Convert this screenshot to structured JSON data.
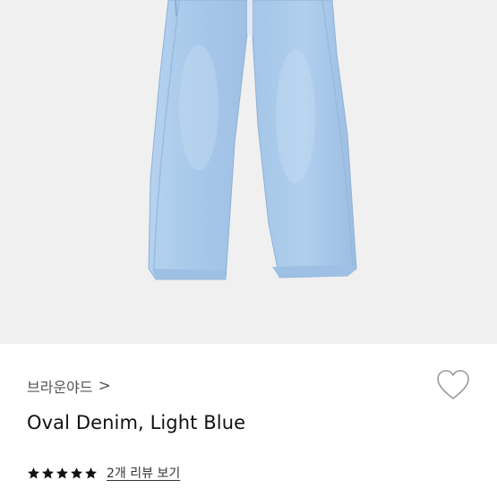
{
  "product": {
    "image_icon": "jeans-photo",
    "brand": "브라운야드",
    "brand_chevron": ">",
    "title": "Oval Denim, Light Blue",
    "rating": 5,
    "rating_max": 5,
    "reviews_link": "2개 리뷰 보기",
    "wishlist_icon": "heart-outline-icon"
  },
  "colors": {
    "denim": "#a9c9ea",
    "denim_dark": "#8fb4dc",
    "background": "#f0f0f0",
    "star": "#111111"
  }
}
